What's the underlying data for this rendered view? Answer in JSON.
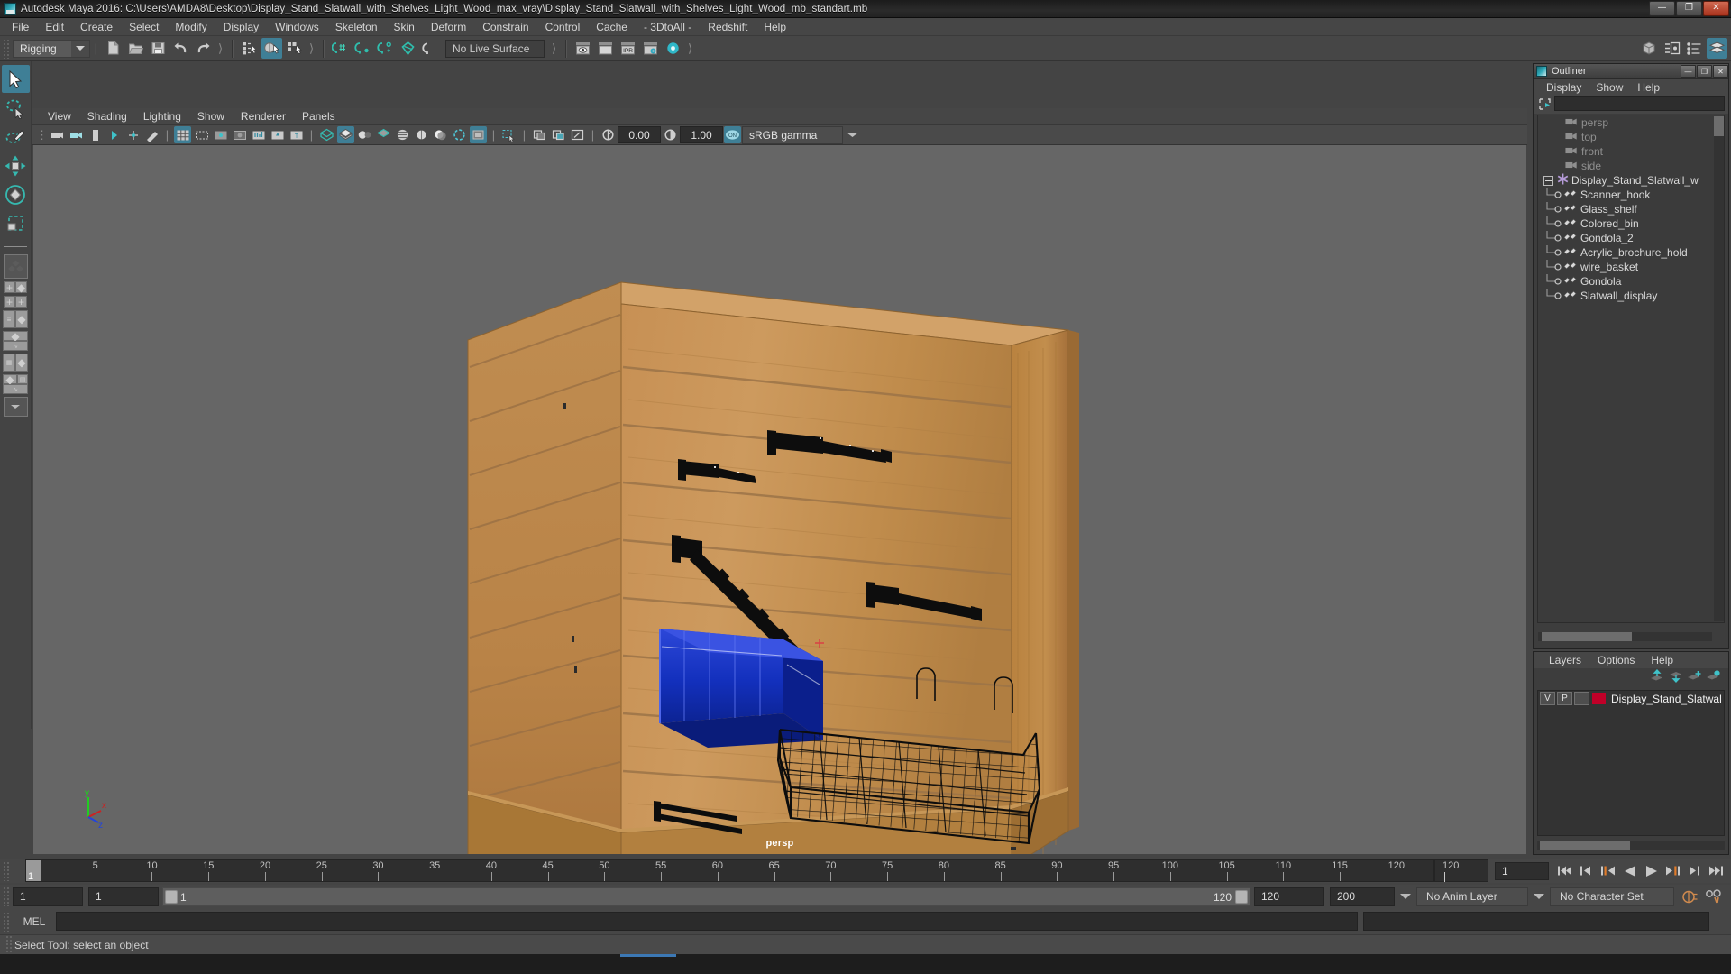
{
  "window": {
    "title": "Autodesk Maya 2016: C:\\Users\\AMDA8\\Desktop\\Display_Stand_Slatwall_with_Shelves_Light_Wood_max_vray\\Display_Stand_Slatwall_with_Shelves_Light_Wood_mb_standart.mb",
    "minimize": "—",
    "maximize": "❐",
    "close": "✕"
  },
  "menubar": {
    "items": [
      "File",
      "Edit",
      "Create",
      "Select",
      "Modify",
      "Display",
      "Windows",
      "Skeleton",
      "Skin",
      "Deform",
      "Constrain",
      "Control",
      "Cache",
      "- 3DtoAll -",
      "Redshift",
      "Help"
    ]
  },
  "statusline": {
    "menuset": "Rigging",
    "live_surface": "No Live Surface",
    "numeric_input_a": "0.00",
    "numeric_input_b": "1.00",
    "color_management": "sRGB gamma",
    "ipr_label": "IPR",
    "icons": [
      "new-scene-icon",
      "open-scene-icon",
      "save-scene-icon",
      "undo-icon",
      "redo-icon",
      "select-by-hierarchy-icon",
      "select-by-object-icon",
      "select-by-component-icon",
      "snap-to-grid-icon",
      "snap-to-curve-icon",
      "snap-to-point-icon",
      "snap-to-projected-center-icon",
      "snap-to-view-plane-icon",
      "make-live-icon",
      "render-current-frame-icon",
      "render-sequence-icon",
      "ipr-render-icon",
      "render-settings-icon",
      "hypershade-icon"
    ]
  },
  "toolbox": {
    "items": [
      {
        "name": "select-tool",
        "selected": true
      },
      {
        "name": "lasso-select-tool",
        "selected": false
      },
      {
        "name": "paint-select-tool",
        "selected": false
      },
      {
        "name": "move-tool",
        "selected": false
      },
      {
        "name": "rotate-tool",
        "selected": false
      },
      {
        "name": "scale-tool",
        "selected": false
      }
    ],
    "layout_presets": [
      "single-perspective-layout",
      "four-view-layout",
      "outliner-persp-layout",
      "persp-graph-layout",
      "hypershade-persp-layout",
      "persp-trax-layout",
      "more-layouts"
    ]
  },
  "viewport": {
    "menus": [
      "View",
      "Shading",
      "Lighting",
      "Show",
      "Renderer",
      "Panels"
    ],
    "camera_label": "persp",
    "exposure": "0.00",
    "gamma": "1.00",
    "color_profile": "sRGB gamma",
    "gizmo": {
      "x": "x",
      "y": "y",
      "z": "z"
    },
    "background_color": "#666666",
    "scene": {
      "description": "Wooden slatwall retail display stand with black slatwall hooks, faceouts, a blue plastic bin and a black wire basket",
      "wood_color": "#c08c4e",
      "bin_color": "#1634c8",
      "hardware_color": "#111111"
    }
  },
  "outliner": {
    "title": "Outliner",
    "menus": [
      "Display",
      "Show",
      "Help"
    ],
    "search_value": "",
    "tree": [
      {
        "label": "persp",
        "type": "camera",
        "depth": 1
      },
      {
        "label": "top",
        "type": "camera",
        "depth": 1
      },
      {
        "label": "front",
        "type": "camera",
        "depth": 1
      },
      {
        "label": "side",
        "type": "camera",
        "depth": 1
      },
      {
        "label": "Display_Stand_Slatwall_w",
        "type": "group",
        "depth": 0,
        "expanded": true
      },
      {
        "label": "Scanner_hook",
        "type": "mesh",
        "depth": 1
      },
      {
        "label": "Glass_shelf",
        "type": "mesh",
        "depth": 1
      },
      {
        "label": "Colored_bin",
        "type": "mesh",
        "depth": 1
      },
      {
        "label": "Gondola_2",
        "type": "mesh",
        "depth": 1
      },
      {
        "label": "Acrylic_brochure_hold",
        "type": "mesh",
        "depth": 1
      },
      {
        "label": "wire_basket",
        "type": "mesh",
        "depth": 1
      },
      {
        "label": "Gondola",
        "type": "mesh",
        "depth": 1
      },
      {
        "label": "Slatwall_display",
        "type": "mesh",
        "depth": 1
      }
    ],
    "window_buttons": {
      "minimize": "—",
      "maximize": "❐",
      "close": "✕"
    }
  },
  "layer_editor": {
    "menus": [
      "Layers",
      "Options",
      "Help"
    ],
    "buttons": [
      "move-layer-up-icon",
      "move-layer-down-icon",
      "new-layer-icon",
      "new-layer-from-selected-icon"
    ],
    "columns": {
      "visibility": "V",
      "playback": "P"
    },
    "rows": [
      {
        "v": "V",
        "p": "P",
        "shading": "",
        "color": "#c00028",
        "name": "Display_Stand_Slatwal"
      }
    ]
  },
  "timeline": {
    "ticks": [
      5,
      10,
      15,
      20,
      25,
      30,
      35,
      40,
      45,
      50,
      55,
      60,
      65,
      70,
      75,
      80,
      85,
      90,
      95,
      100,
      105,
      110,
      115,
      120
    ],
    "current_frame": "1",
    "end_display": "120",
    "current_frame_field": "1",
    "playback_buttons": [
      "go-to-start-icon",
      "step-back-frame-icon",
      "step-back-key-icon",
      "play-backwards-icon",
      "play-forwards-icon",
      "step-forward-key-icon",
      "step-forward-frame-icon",
      "go-to-end-icon"
    ]
  },
  "range_slider": {
    "start_field": "1",
    "range_start_field": "1",
    "bar_start_label": "1",
    "bar_end_label": "120",
    "range_end_field": "120",
    "end_field": "200",
    "anim_layer": "No Anim Layer",
    "character_set": "No Character Set",
    "extra_icons": [
      "auto-key-icon",
      "animation-preferences-icon"
    ]
  },
  "command_line": {
    "language": "MEL",
    "input_value": "",
    "output_value": ""
  },
  "help_line": {
    "text": "Select Tool: select an object"
  }
}
